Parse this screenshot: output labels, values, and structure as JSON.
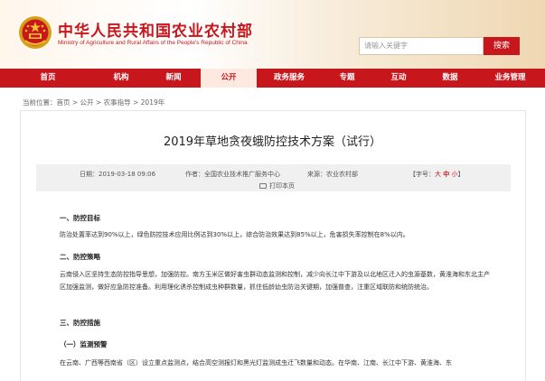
{
  "header": {
    "site_title": "中华人民共和国农业农村部",
    "site_subtitle": "Ministry of Agriculture and Rural Affairs of the People's Republic of China",
    "search_placeholder": "请输入关键字",
    "search_button": "搜索"
  },
  "nav": {
    "items": [
      "首页",
      "机构",
      "新闻",
      "公开",
      "政务服务",
      "专题",
      "互动",
      "数据",
      "业务管理"
    ],
    "active_index": 3
  },
  "breadcrumb": "当前位置：首页 > 公开 > 农事指导 > 2019年",
  "article": {
    "title": "2019年草地贪夜蛾防控技术方案（试行）",
    "date": "日期：2019-03-18 09:06",
    "author": "作者：全国农业技术推广服务中心",
    "source": "来源：农业农村部",
    "font_prefix": "【字号：",
    "font_large": "大",
    "font_mid": "中",
    "font_small": "小",
    "font_suffix": "】",
    "print": "打印本页",
    "sections": [
      {
        "heading": "一、防控目标",
        "text": "防治处置率达到90%以上，绿色防控技术应用比例达到30%以上，综合防治效果达到85%以上，危害损失率控制在8%以内。"
      },
      {
        "heading": "二、防控策略",
        "text": "云南侵入区坚持生态防控指导思想，加强防控。南方玉米区做好害虫群动态监测和控制，减少向长江中下游及以北地区迁入的虫源基数，黄淮海和东北主产区加强监测，做好应急防控准备。利用理化诱杀控制成虫种群数量，抓住低龄幼虫防治关键期，加强普查，注重区域联防和统防统治。"
      },
      {
        "heading": "三、防控措施",
        "text": ""
      }
    ],
    "subheading": "（一）监测预警",
    "subtext": "在云南、广西等西南省（区）设立重点监测点，结合高空测报灯和黑光灯监测成虫迁飞数量和动态。在华南、江南、长江中下游、黄淮海、东"
  },
  "colors": {
    "brand_red": "#c8161d",
    "nav_active_bg": "#fde9e0"
  }
}
